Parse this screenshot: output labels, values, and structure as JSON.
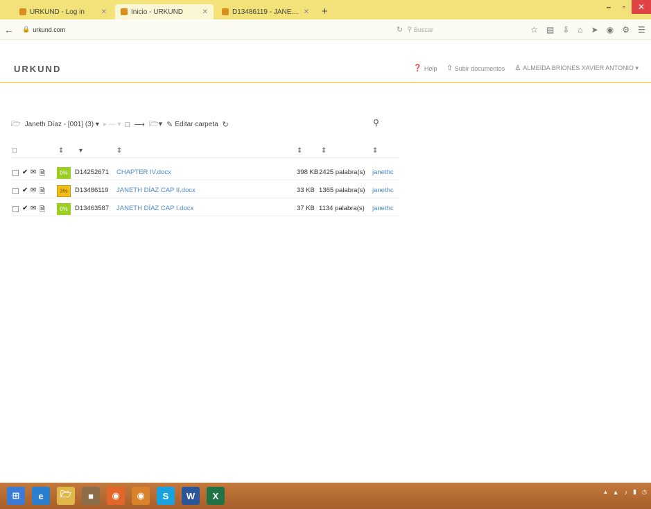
{
  "browser": {
    "tabs": [
      {
        "title": "URKUND - Log in",
        "active": false
      },
      {
        "title": "Inicio - URKUND",
        "active": true
      },
      {
        "title": "D13486119 - JANETH DÍAZ ...",
        "active": false
      }
    ],
    "new_tab": "+",
    "url_host": "urkund.com",
    "search_placeholder": "Buscar",
    "window_controls": {
      "minimize": "–",
      "maximize": "▫",
      "close": "✕"
    }
  },
  "app": {
    "logo": "URKUND",
    "help_label": "Help",
    "upload_label": "Subir documentos",
    "user_label": "ALMEIDA BRIONES XAVIER ANTONIO ▾"
  },
  "toolbar": {
    "folder_label": "Janeth Díaz - [001] (3) ▾",
    "edit_folder_label": "Editar carpeta",
    "icons": [
      "folder-open-icon",
      "new-document-icon",
      "move-icon",
      "folder-menu-icon",
      "edit-icon",
      "refresh-icon",
      "search-icon"
    ]
  },
  "table": {
    "headers": [
      "⇕",
      "▾",
      "⇕",
      "⇕",
      "⇕",
      "⇕"
    ],
    "rows": [
      {
        "similarity": "0%",
        "status": "ok",
        "doc_id": "D14252671",
        "filename": "CHAPTER IV.docx",
        "size": "398 KB",
        "words": "2425 palabra(s)",
        "owner": "janethc"
      },
      {
        "similarity": "3%",
        "status": "warn",
        "doc_id": "D13486119",
        "filename": "JANETH DÍAZ CAP II.docx",
        "size": "33 KB",
        "words": "1365 palabra(s)",
        "owner": "janethc"
      },
      {
        "similarity": "0%",
        "status": "ok",
        "doc_id": "D13463587",
        "filename": "JANETH DÍAZ CAP I.docx",
        "size": "37 KB",
        "words": "1134 palabra(s)",
        "owner": "janethc"
      }
    ]
  },
  "colors": {
    "accent": "#4a89c8",
    "ok_badge": "#9ccd22",
    "warn_badge": "#f0c018",
    "header_line": "#f2d67a"
  }
}
